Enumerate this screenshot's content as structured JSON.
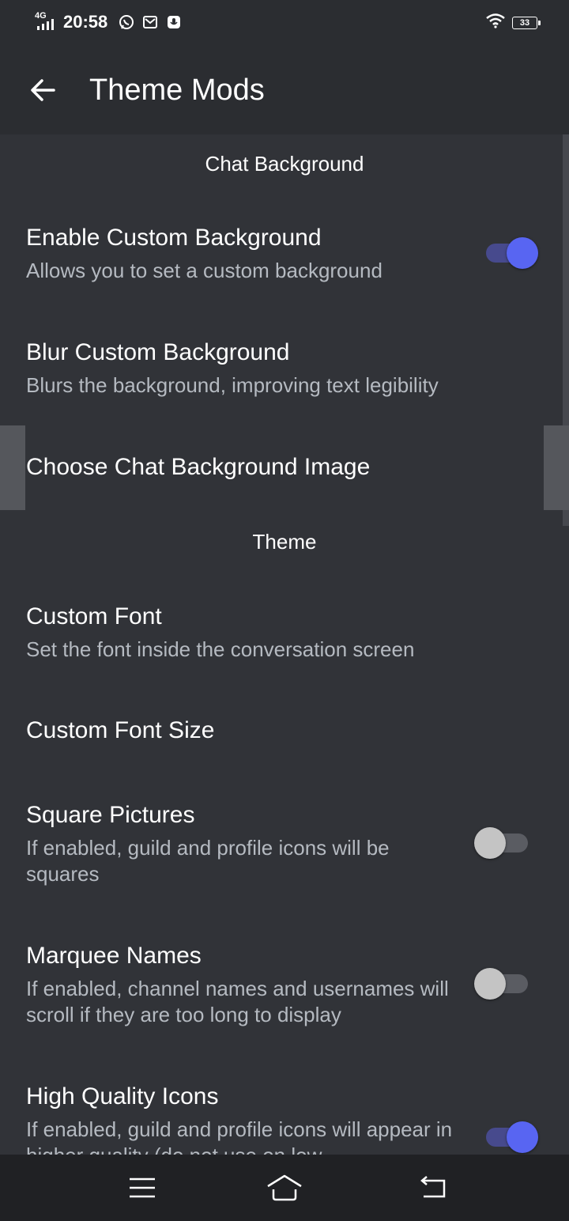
{
  "status_bar": {
    "network": "4G",
    "time": "20:58",
    "battery": "33",
    "icons": [
      "whatsapp-icon",
      "gmail-icon",
      "voice-recorder-icon",
      "wifi-icon",
      "battery-icon"
    ]
  },
  "app_bar": {
    "title": "Theme Mods",
    "back_icon": "arrow-left-icon"
  },
  "sections": {
    "chat_background": "Chat Background",
    "theme": "Theme"
  },
  "settings": {
    "enable_custom_background": {
      "title": "Enable Custom Background",
      "subtitle": "Allows you to set a custom background",
      "enabled": true
    },
    "blur_custom_background": {
      "title": "Blur Custom Background",
      "subtitle": "Blurs the background, improving text legibility"
    },
    "choose_chat_background_image": {
      "title": "Choose Chat Background Image"
    },
    "custom_font": {
      "title": "Custom Font",
      "subtitle": "Set the font inside the conversation screen"
    },
    "custom_font_size": {
      "title": "Custom Font Size"
    },
    "square_pictures": {
      "title": "Square Pictures",
      "subtitle": "If enabled, guild and profile icons will be squares",
      "enabled": false
    },
    "marquee_names": {
      "title": "Marquee Names",
      "subtitle": "If enabled, channel names and usernames will scroll if they are too long to display",
      "enabled": false
    },
    "high_quality_icons": {
      "title": "High Quality Icons",
      "subtitle": "If enabled, guild and profile icons will appear in higher quality (do not use on low",
      "enabled": true
    }
  },
  "nav_bar": {
    "icons": [
      "menu-icon",
      "home-icon",
      "back-icon"
    ]
  },
  "colors": {
    "background": "#313338",
    "header": "#2b2d31",
    "accent": "#5865f2",
    "subtext": "#b5bac1"
  }
}
